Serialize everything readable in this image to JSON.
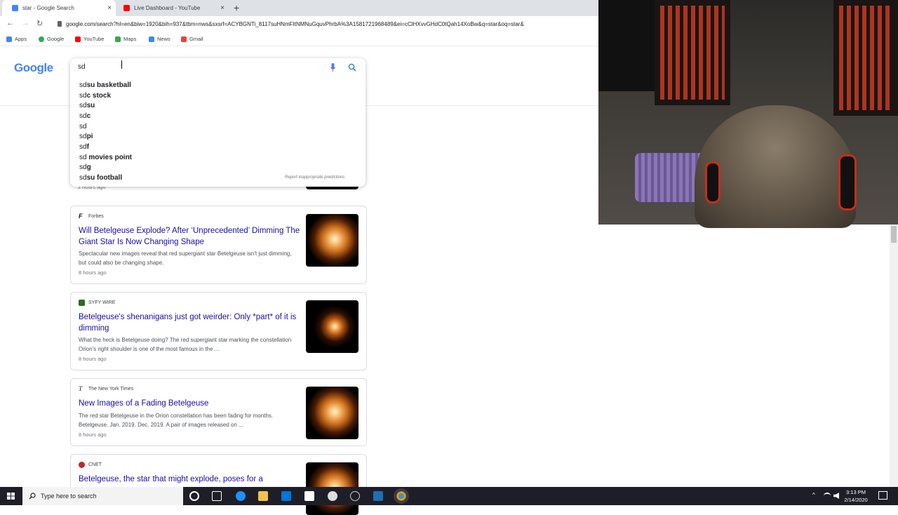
{
  "browser": {
    "tabs": [
      {
        "label": "star - Google Search",
        "active": true
      },
      {
        "label": "Live Dashboard - YouTube",
        "active": false
      }
    ],
    "new_tab_label": "+",
    "close_glyph": "×",
    "url": "google.com/search?hl=en&biw=1920&bih=937&tbm=nws&sxsrf=ACYBGNTi_8117suHNmFItNMNuGquvPhrbA%3A1581721968489&ei=cClHXvvGHdC0tQah14XoBw&q=star&oq=star&",
    "nav": {
      "back": "←",
      "forward": "→",
      "reload": "↻"
    },
    "bookmarks": [
      "Apps",
      "Google",
      "YouTube",
      "Maps",
      "News",
      "Gmail"
    ]
  },
  "google": {
    "logo": "Google",
    "search_value": "sd",
    "suggestions": [
      {
        "prefix": "sd",
        "rest": "su basketball"
      },
      {
        "prefix": "sd",
        "rest": "c stock"
      },
      {
        "prefix": "sd",
        "rest": "su"
      },
      {
        "prefix": "sd",
        "rest": "c"
      },
      {
        "prefix": "sd",
        "rest": ""
      },
      {
        "prefix": "sd",
        "rest": "pi"
      },
      {
        "prefix": "sd",
        "rest": "f"
      },
      {
        "prefix": "sd",
        "rest": " movies point"
      },
      {
        "prefix": "sd",
        "rest": "g"
      },
      {
        "prefix": "sd",
        "rest": "su football"
      }
    ],
    "report_link": "Report inappropriate predictions",
    "partial_time": "2 hours ago"
  },
  "news": [
    {
      "source": "Forbes",
      "source_color": "#111111",
      "title": "Will Betelgeuse Explode? After ‘Unprecedented’ Dimming The Giant Star Is Now Changing Shape",
      "snippet": "Spectacular new images reveal that red supergiant star Betelgeuse isn't just dimming, but could also be changing shape.",
      "time": "8 hours ago"
    },
    {
      "source": "SYFY WIRE",
      "source_color": "#2b2b2b",
      "title": "Betelgeuse's shenanigans just got weirder: Only *part* of it is dimming",
      "snippet": "What the heck is Betelgeuse doing? The red supergiant star marking the constellation Orion's right shoulder is one of the most famous in the ...",
      "time": "8 hours ago"
    },
    {
      "source": "The New York Times",
      "source_color": "#111111",
      "title": "New Images of a Fading Betelgeuse",
      "snippet": "The red star Betelgeuse in the Orion constellation has been fading for months. Betelgeuse. Jan. 2019. Dec. 2019. A pair of images released on ...",
      "time": "8 hours ago"
    },
    {
      "source": "CNET",
      "source_color": "#c0272d",
      "title": "Betelgeuse, the star that might explode, poses for a",
      "snippet": "",
      "time": ""
    }
  ],
  "taskbar": {
    "search_placeholder": "Type here to search",
    "time": "3:13 PM",
    "date": "2/14/2020"
  }
}
